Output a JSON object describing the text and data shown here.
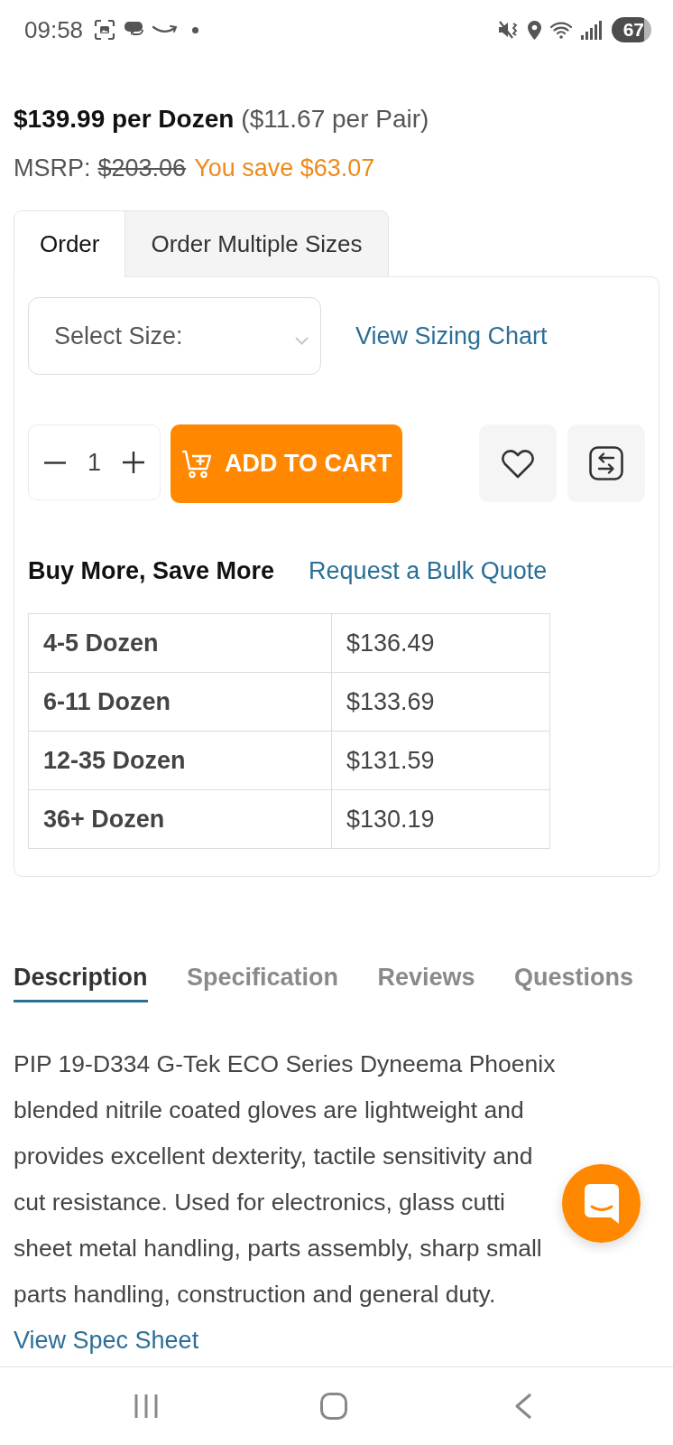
{
  "status_bar": {
    "time": "09:58",
    "battery": "67"
  },
  "price": {
    "per_dozen": "$139.99 per Dozen",
    "per_pair": "($11.67 per Pair)",
    "msrp_label": "MSRP:",
    "msrp": "$203.06",
    "savings": "You save $63.07"
  },
  "order_tabs": [
    {
      "label": "Order",
      "selected": true
    },
    {
      "label": "Order Multiple Sizes",
      "selected": false
    }
  ],
  "size_select": {
    "placeholder": "Select Size:"
  },
  "sizing_chart_link": "View Sizing Chart",
  "quantity": {
    "value": "1"
  },
  "add_to_cart": "ADD TO CART",
  "bulk_pricing": {
    "title": "Buy More, Save More",
    "link": "Request a Bulk Quote",
    "tiers": [
      {
        "range": "4-5 Dozen",
        "price": "$136.49"
      },
      {
        "range": "6-11 Dozen",
        "price": "$133.69"
      },
      {
        "range": "12-35 Dozen",
        "price": "$131.59"
      },
      {
        "range": "36+ Dozen",
        "price": "$130.19"
      }
    ]
  },
  "detail_tabs": [
    {
      "label": "Description",
      "selected": true
    },
    {
      "label": "Specification",
      "selected": false
    },
    {
      "label": "Reviews",
      "selected": false
    },
    {
      "label": "Questions",
      "selected": false
    }
  ],
  "description": {
    "lines": [
      "PIP 19-D334 G-Tek ECO Series Dyneema Phoenix",
      "blended nitrile coated gloves are lightweight and",
      "provides excellent dexterity, tactile sensitivity and",
      "cut resistance. Used for electronics, glass cutti",
      "sheet metal handling, parts assembly, sharp small",
      "parts handling, construction and general duty."
    ],
    "link": "View Spec Sheet"
  }
}
